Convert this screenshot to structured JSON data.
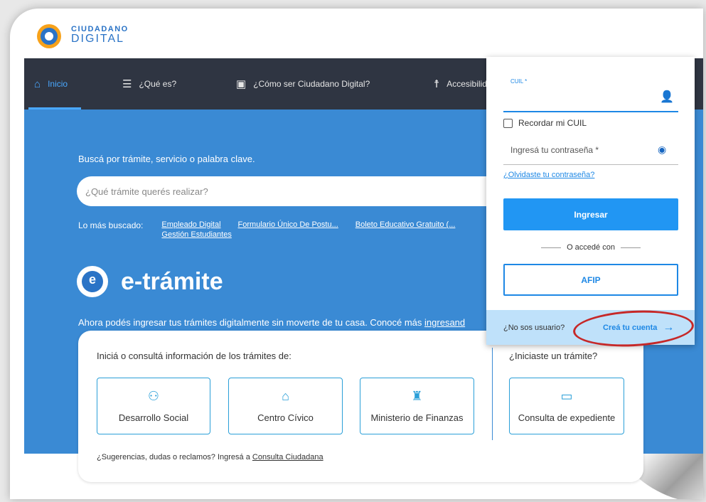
{
  "logo": {
    "line1": "CIUDADANO",
    "line2": "DIGITAL"
  },
  "nav": [
    {
      "label": "Inicio",
      "icon": "home-icon",
      "glyph": "⌂"
    },
    {
      "label": "¿Qué es?",
      "icon": "list-icon",
      "glyph": "☰"
    },
    {
      "label": "¿Cómo ser Ciudadano Digital?",
      "icon": "id-card-icon",
      "glyph": "▣"
    },
    {
      "label": "Accesibilidad",
      "icon": "accessibility-icon",
      "glyph": "☨"
    }
  ],
  "hero": {
    "search_label": "Buscá por trámite, servicio o palabra clave.",
    "search_placeholder": "¿Qué trámite querés realizar?",
    "popular_label": "Lo más buscado:",
    "popular_links": [
      "Empleado Digital",
      "Formulario Único De Postu...",
      "Boleto Educativo Gratuito (...",
      "Gestión Estudiantes"
    ],
    "brand": "e-trámite",
    "subtitle": "Ahora podés ingresar tus trámites digitalmente sin moverte de tu casa. Conocé más",
    "subtitle_link": "ingresand"
  },
  "card": {
    "title_left": "Iniciá o consultá información de los trámites de:",
    "title_right": "¿Iniciaste un trámite?",
    "tiles": [
      {
        "label": "Desarrollo Social",
        "icon": "people-icon",
        "glyph": "⚇"
      },
      {
        "label": "Centro Cívico",
        "icon": "building-icon",
        "glyph": "⌂"
      },
      {
        "label": "Ministerio de Finanzas",
        "icon": "tower-icon",
        "glyph": "♜"
      },
      {
        "label": "Consulta de expediente",
        "icon": "folder-icon",
        "glyph": "▭"
      }
    ],
    "footer": "¿Sugerencias, dudas o reclamos? Ingresá a",
    "footer_link": "Consulta Ciudadana"
  },
  "login": {
    "cuil_label": "CUIL *",
    "remember": "Recordar mi CUIL",
    "password_placeholder": "Ingresá tu contraseña *",
    "forgot": "¿Olvidaste tu contraseña?",
    "submit": "Ingresar",
    "or": "O accedé con",
    "afip": "AFIP",
    "no_user": "¿No sos usuario?",
    "create": "Creá tu cuenta",
    "user_glyph": "👤",
    "eye_glyph": "◉",
    "arrow_glyph": "→"
  }
}
